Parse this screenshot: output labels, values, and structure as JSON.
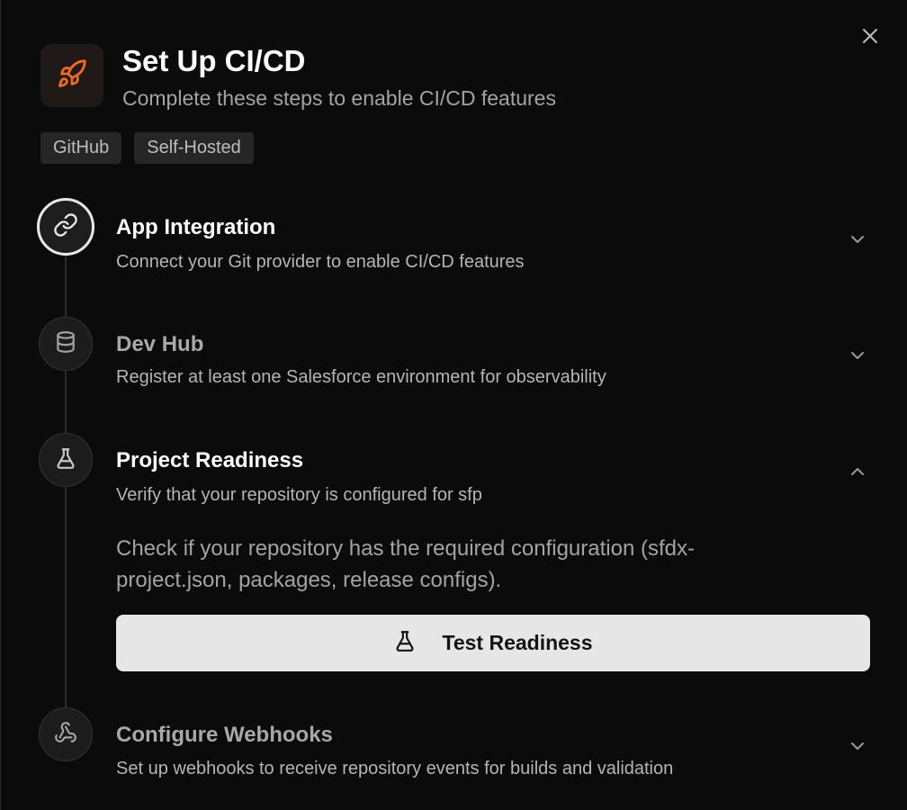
{
  "header": {
    "title": "Set Up CI/CD",
    "subtitle": "Complete these steps to enable CI/CD features",
    "icon": "rocket-icon",
    "accent_color": "#f26b1d"
  },
  "badges": [
    "GitHub",
    "Self-Hosted"
  ],
  "steps": [
    {
      "title": "App Integration",
      "description": "Connect your Git provider to enable CI/CD features",
      "icon": "link-icon",
      "state": "active",
      "expanded": false
    },
    {
      "title": "Dev Hub",
      "description": "Register at least one Salesforce environment for observability",
      "icon": "database-icon",
      "state": "pending",
      "expanded": false
    },
    {
      "title": "Project Readiness",
      "description": "Verify that your repository is configured for sfp",
      "icon": "flask-icon",
      "state": "current",
      "expanded": true,
      "body": "Check if your repository has the required configuration (sfdx-project.json, packages, release configs).",
      "button_label": "Test Readiness",
      "button_icon": "flask-icon"
    },
    {
      "title": "Configure Webhooks",
      "description": "Set up webhooks to receive repository events for builds and validation",
      "icon": "webhook-icon",
      "state": "pending",
      "expanded": false
    }
  ]
}
